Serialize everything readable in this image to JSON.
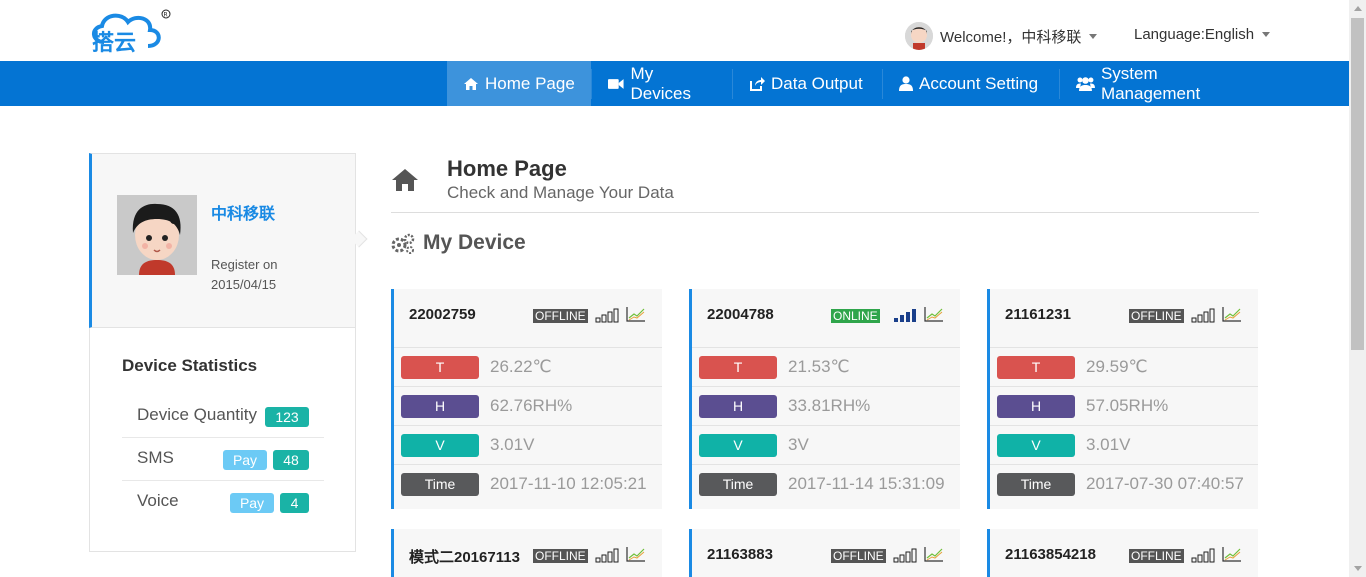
{
  "header": {
    "welcome_text": "Welcome!，中科移联",
    "language_text": "Language:English"
  },
  "nav": {
    "items": [
      {
        "label": "Home Page",
        "icon": "home-icon",
        "active": true
      },
      {
        "label": "My Devices",
        "icon": "video-camera-icon",
        "active": false
      },
      {
        "label": "Data Output",
        "icon": "export-icon",
        "active": false
      },
      {
        "label": "Account Setting",
        "icon": "user-icon",
        "active": false
      },
      {
        "label": "System Management",
        "icon": "users-icon",
        "active": false
      }
    ]
  },
  "profile": {
    "name": "中科移联",
    "register_label": "Register on",
    "register_date": "2015/04/15"
  },
  "stats": {
    "title": "Device Statistics",
    "rows": [
      {
        "label": "Device Quantity",
        "count": "123"
      },
      {
        "label": "SMS",
        "pay": "Pay",
        "count": "48"
      },
      {
        "label": "Voice",
        "pay": "Pay",
        "count": "4"
      }
    ]
  },
  "page": {
    "title": "Home Page",
    "subtitle": "Check and Manage Your Data",
    "section_title": "My Device"
  },
  "metric_labels": {
    "t": "T",
    "h": "H",
    "v": "V",
    "time": "Time"
  },
  "devices": [
    {
      "id": "22002759",
      "status": "OFFLINE",
      "signal": 0,
      "t": "26.22℃",
      "h": "62.76RH%",
      "v": "3.01V",
      "time": "2017-11-10 12:05:21"
    },
    {
      "id": "22004788",
      "status": "ONLINE",
      "signal": 4,
      "t": "21.53℃",
      "h": "33.81RH%",
      "v": "3V",
      "time": "2017-11-14 15:31:09"
    },
    {
      "id": "21161231",
      "status": "OFFLINE",
      "signal": 0,
      "t": "29.59℃",
      "h": "57.05RH%",
      "v": "3.01V",
      "time": "2017-07-30 07:40:57"
    },
    {
      "id": "模式二20167113",
      "status": "OFFLINE",
      "signal": 0
    },
    {
      "id": "21163883",
      "status": "OFFLINE",
      "signal": 0
    },
    {
      "id": "21163854218",
      "status": "OFFLINE",
      "signal": 0
    }
  ],
  "colors": {
    "nav_bg": "#0474d3",
    "nav_active": "#3d93dc",
    "accent": "#1a8ae4",
    "label_t": "#d9534f",
    "label_h": "#5b4e91",
    "label_v": "#10b2a7",
    "label_time": "#58595b",
    "online": "#2fa54b",
    "offline": "#555555"
  }
}
